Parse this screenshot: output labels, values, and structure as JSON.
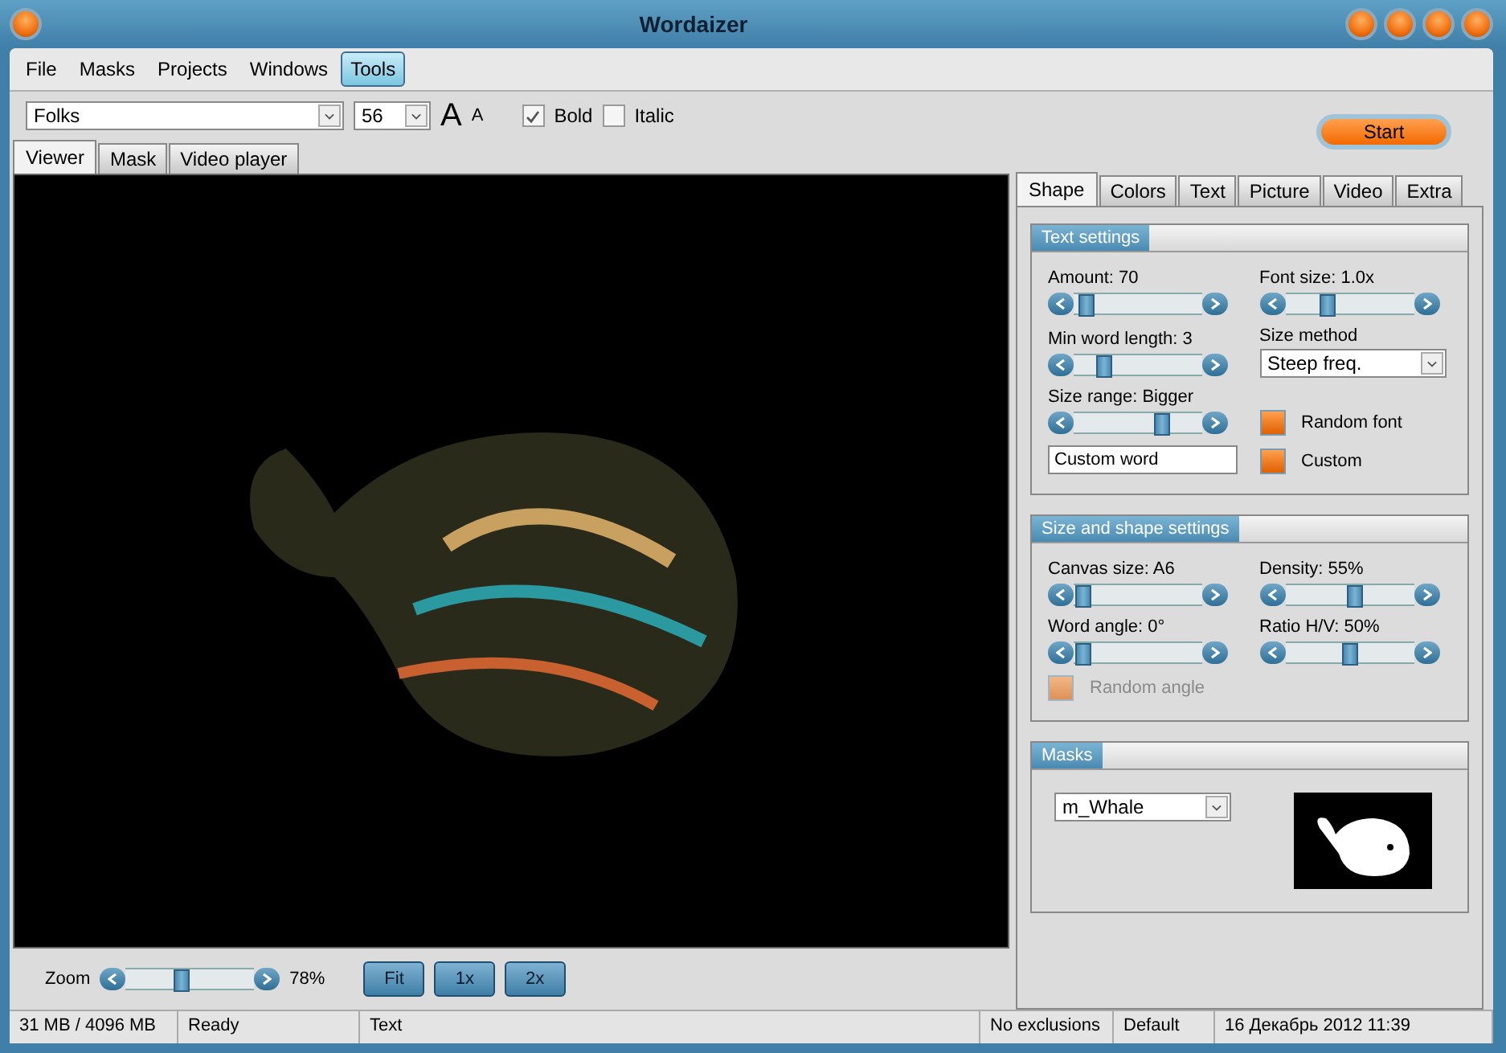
{
  "window": {
    "title": "Wordaizer"
  },
  "menu": [
    {
      "label": "File",
      "selected": false
    },
    {
      "label": "Masks",
      "selected": false
    },
    {
      "label": "Projects",
      "selected": false
    },
    {
      "label": "Windows",
      "selected": false
    },
    {
      "label": "Tools",
      "selected": true
    }
  ],
  "toolbar": {
    "font": "Folks",
    "size": "56",
    "grow_label": "A",
    "shrink_label": "A",
    "bold": {
      "label": "Bold",
      "checked": true
    },
    "italic": {
      "label": "Italic",
      "checked": false
    },
    "start": "Start"
  },
  "view_tabs": [
    {
      "label": "Viewer",
      "selected": true
    },
    {
      "label": "Mask",
      "selected": false
    },
    {
      "label": "Video player",
      "selected": false
    }
  ],
  "zoom": {
    "label": "Zoom",
    "level": 0.42,
    "reading": "78%",
    "buttons": [
      "Fit",
      "1x",
      "2x"
    ]
  },
  "settings_tabs": [
    {
      "label": "Shape",
      "selected": true
    },
    {
      "label": "Colors",
      "selected": false
    },
    {
      "label": "Text",
      "selected": false
    },
    {
      "label": "Picture",
      "selected": false
    },
    {
      "label": "Video",
      "selected": false
    },
    {
      "label": "Extra",
      "selected": false
    }
  ],
  "text_settings": {
    "title": "Text settings",
    "items": [
      {
        "kind": "slider",
        "label": "Amount: 70",
        "level": 0.04
      },
      {
        "kind": "slider",
        "label": "Font size: 1.0x",
        "level": 0.3
      },
      {
        "kind": "slider",
        "label": "Min word length: 3",
        "level": 0.2
      },
      {
        "kind": "select",
        "label": "Size method",
        "value": "Steep freq."
      },
      {
        "kind": "slider",
        "label": "Size range: Bigger",
        "level": 0.72
      },
      {
        "kind": "checkbox",
        "label": "Random font",
        "checked": true,
        "disabled": false
      },
      {
        "kind": "input",
        "value": "Custom word"
      },
      {
        "kind": "checkbox",
        "label": "Custom",
        "checked": true,
        "disabled": false
      }
    ]
  },
  "shape_settings": {
    "title": "Size and shape settings",
    "items": [
      {
        "kind": "slider",
        "label": "Canvas size: A6",
        "level": 0.02
      },
      {
        "kind": "slider",
        "label": "Density: 55%",
        "level": 0.55
      },
      {
        "kind": "slider",
        "label": "Word angle: 0°",
        "level": 0.02
      },
      {
        "kind": "slider",
        "label": "Ratio H/V: 50%",
        "level": 0.5
      },
      {
        "kind": "checkbox",
        "label": "Random angle",
        "checked": true,
        "disabled": true
      }
    ]
  },
  "masks": {
    "title": "Masks",
    "value": "m_Whale"
  },
  "status_bar": [
    "31 MB / 4096 MB",
    "Ready",
    "Text",
    "No exclusions",
    "Default",
    "16 Декабрь 2012 11:39"
  ]
}
